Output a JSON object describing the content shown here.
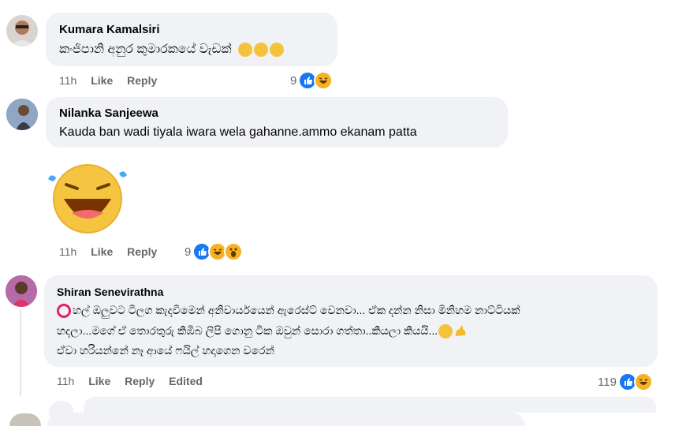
{
  "comments": [
    {
      "author": "Kumara Kamalsiri",
      "text": "කංජිපානි අනුර කුමාරකයේ වැඩක්",
      "time": "11h",
      "like": "Like",
      "reply": "Reply",
      "reactions": "9"
    },
    {
      "author": "Nilanka Sanjeewa",
      "text": "Kauda ban wadi tiyala iwara wela gahanne.ammo ekanam patta",
      "time": "11h",
      "like": "Like",
      "reply": "Reply",
      "reactions": "9"
    },
    {
      "author": "Shiran Senevirathna",
      "lines": [
        "හල් ඔලුවට ටීලග කැදවීමෙන් අනිවාර්යයෙන් ඇරෙස්ට් වෙනවා... ඒක දන්න නිසා මිනිහම නාට්ටියක්",
        "හදලා...මගේ ඒ තොරතුරු කිඹිබ ලිපි ගොනු ටික ඔවුන් සොරා ගත්තා..කියලා කියයි...",
        "ඒවා හරියන්නේ නෑ ආයේ ෆයිල් හදාගෙන වරෙන්"
      ],
      "time": "11h",
      "like": "Like",
      "reply": "Reply",
      "edited": "Edited",
      "reactions": "119"
    }
  ],
  "colors": {
    "bubble": "#f0f2f5",
    "like_blue": "#1877f2",
    "secondary_text": "#65676b",
    "emoji_yellow": "#f5c33b"
  },
  "icons": [
    "like-reaction-icon",
    "haha-reaction-icon",
    "wow-reaction-icon",
    "red-circle-icon",
    "flexed-biceps-icon"
  ]
}
